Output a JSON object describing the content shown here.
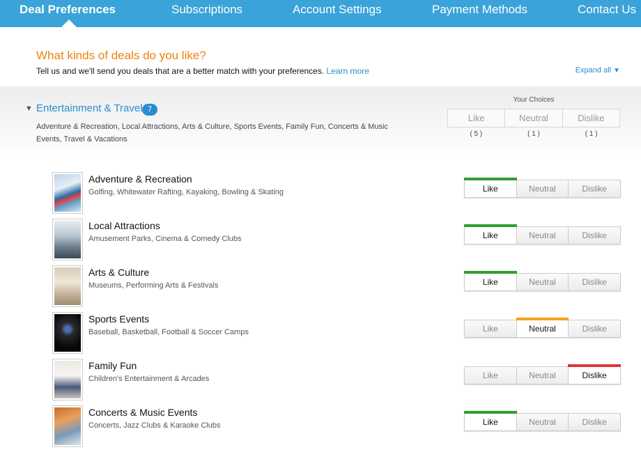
{
  "nav": {
    "tabs": [
      {
        "label": "Deal Preferences",
        "active": true
      },
      {
        "label": "Subscriptions"
      },
      {
        "label": "Account Settings"
      },
      {
        "label": "Payment Methods"
      },
      {
        "label": "Contact Us"
      }
    ],
    "color": "#3aa3d9"
  },
  "intro": {
    "title": "What kinds of deals do you like?",
    "text": "Tell us and we'll send you deals that are a better match with your preferences.",
    "learn_more": "Learn more",
    "expand_all": "Expand all",
    "title_color": "#f0810f"
  },
  "category": {
    "title": "Entertainment & Travel",
    "count": "7",
    "subtitle": "Adventure & Recreation, Local Attractions, Arts & Culture, Sports Events, Family Fun, Concerts & Music Events, Travel & Vacations",
    "your_choices": "Your Choices",
    "summary": [
      {
        "label": "Like",
        "count": "( 5 )"
      },
      {
        "label": "Neutral",
        "count": "( 1 )"
      },
      {
        "label": "Dislike",
        "count": "( 1 )"
      }
    ]
  },
  "choice_labels": [
    "Like",
    "Neutral",
    "Dislike"
  ],
  "colors": {
    "like": "#2f9e2f",
    "neutral": "#f2a21a",
    "dislike": "#e03535",
    "link": "#2a8ccf"
  },
  "items": [
    {
      "title": "Adventure & Recreation",
      "subtitle": "Golfing, Whitewater Rafting, Kayaking, Bowling & Skating",
      "selected": "Like",
      "image": "kayaker-photo"
    },
    {
      "title": "Local Attractions",
      "subtitle": "Amusement Parks, Cinema & Comedy Clubs",
      "selected": "Like",
      "image": "ferris-wheel-photo"
    },
    {
      "title": "Arts & Culture",
      "subtitle": "Museums, Performing Arts & Festivals",
      "selected": "Like",
      "image": "dancer-photo"
    },
    {
      "title": "Sports Events",
      "subtitle": "Baseball, Basketball, Football & Soccer Camps",
      "selected": "Neutral",
      "image": "soccer-player-photo"
    },
    {
      "title": "Family Fun",
      "subtitle": "Children's Entertainment & Arcades",
      "selected": "Dislike",
      "image": "family-photo"
    },
    {
      "title": "Concerts & Music Events",
      "subtitle": "Concerts, Jazz Clubs & Karaoke Clubs",
      "selected": "Like",
      "image": "concert-photo"
    }
  ]
}
